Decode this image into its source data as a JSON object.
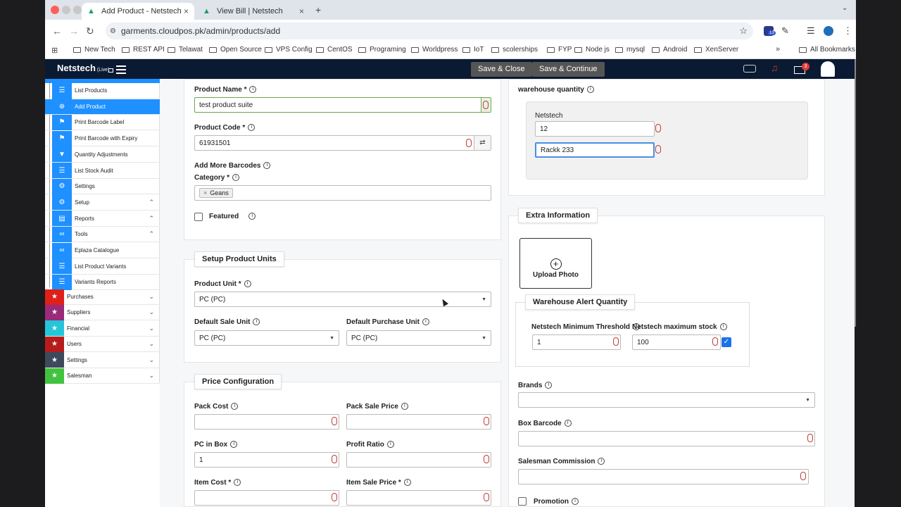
{
  "browser": {
    "tabs": [
      {
        "title": "Add Product - Netstech"
      },
      {
        "title": "View Bill | Netstech"
      }
    ],
    "url": "garments.cloudpos.pk/admin/products/add",
    "bookmarks": [
      "New Tech",
      "REST API",
      "Telawat",
      "Open Source",
      "VPS Config",
      "CentOS",
      "Programing",
      "Worldpress",
      "IoT",
      "scolerships",
      "FYP",
      "Node js",
      "mysql",
      "Android",
      "XenServer"
    ],
    "all_bookmarks": "All Bookmarks",
    "ext_badge": "13"
  },
  "header": {
    "brand": "Netstech",
    "brand_suffix": "(Live)",
    "save_close": "Save & Close",
    "save_continue": "Save & Continue",
    "mail_badge": "3"
  },
  "sidebar": {
    "sub_items": [
      "List Products",
      "Add Product",
      "Print Barcode Label",
      "Print Barcode with Expiry",
      "Quantity Adjustments",
      "List Stock Audit",
      "Settings",
      "Setup",
      "Reports",
      "Tools",
      "Eplaza Catalogue",
      "List Product Variants",
      "Variants Reports"
    ],
    "categories": [
      "Purchases",
      "Suppliers",
      "Financial",
      "Users",
      "Settings",
      "Salesman"
    ],
    "category_colors": [
      "#e0201b",
      "#9b2a7a",
      "#26c6da",
      "#b71c1c",
      "#3d4a5c",
      "#43c23f"
    ]
  },
  "form": {
    "product_name_label": "Product Name *",
    "product_name": "test product suite",
    "product_code_label": "Product Code *",
    "product_code": "61931501",
    "add_barcodes_label": "Add More Barcodes",
    "category_label": "Category *",
    "category_tag": "Geans",
    "featured_label": "Featured",
    "units_title": "Setup Product Units",
    "product_unit_label": "Product Unit *",
    "product_unit": "PC (PC)",
    "sale_unit_label": "Default Sale Unit",
    "sale_unit": "PC (PC)",
    "purchase_unit_label": "Default Purchase Unit",
    "purchase_unit": "PC (PC)",
    "price_title": "Price Configuration",
    "pack_cost_label": "Pack Cost",
    "pack_sale_label": "Pack Sale Price",
    "pc_in_box_label": "PC in Box",
    "pc_in_box": "1",
    "profit_ratio_label": "Profit Ratio",
    "item_cost_label": "Item Cost *",
    "item_sale_label": "Item Sale Price *"
  },
  "right": {
    "wh_qty_label": "warehouse quantity",
    "wh_name": "Netstech",
    "wh_qty": "12",
    "wh_qty2": "Rackk 233",
    "extra_title": "Extra Information",
    "upload_photo": "Upload Photo",
    "alert_title": "Warehouse Alert Quantity",
    "min_label": "Netstech Minimum Threshold",
    "min_value": "1",
    "max_label": "Netstech maximum stock",
    "max_value": "100",
    "brands_label": "Brands",
    "box_barcode_label": "Box Barcode",
    "commission_label": "Salesman Commission",
    "promotion_label": "Promotion"
  }
}
